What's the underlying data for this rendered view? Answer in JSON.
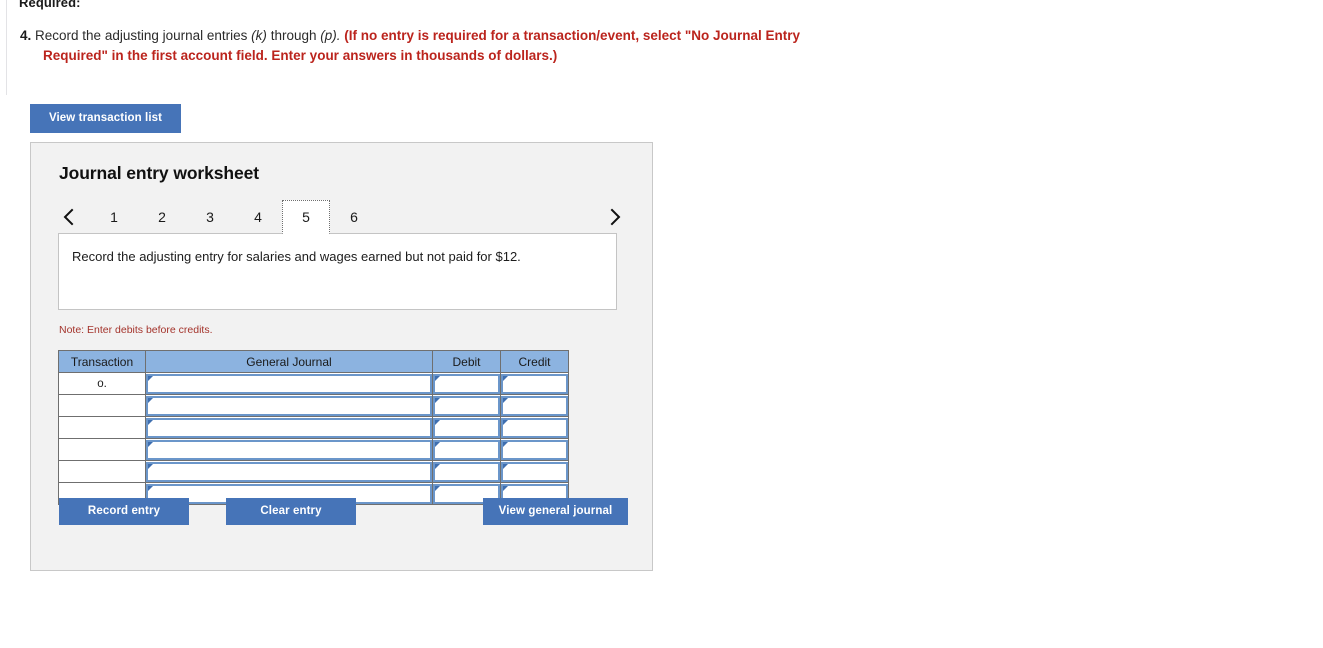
{
  "page": {
    "required_label": "Required:",
    "question": {
      "number": "4.",
      "text_a": "Record the adjusting journal entries",
      "italic_a": "(k)",
      "text_b": "through",
      "italic_b": "(p).",
      "red_a": "(If no entry is required for a transaction/event, select \"No Journal Entry",
      "red_b": "Required\" in the first account field. Enter your answers in thousands of dollars.)"
    },
    "view_transaction_list_label": "View transaction list"
  },
  "worksheet": {
    "title": "Journal entry worksheet",
    "pager": {
      "prev_icon": "chevron-left-icon",
      "next_icon": "chevron-right-icon",
      "pages": [
        "1",
        "2",
        "3",
        "4",
        "5",
        "6"
      ],
      "active_page": "5"
    },
    "prompt": "Record the adjusting entry for salaries and wages earned but not paid for $12.",
    "note": "Note: Enter debits before credits.",
    "table": {
      "headers": [
        "Transaction",
        "General Journal",
        "Debit",
        "Credit"
      ],
      "rows": [
        {
          "transaction": "o.",
          "general_journal": "",
          "debit": "",
          "credit": ""
        },
        {
          "transaction": "",
          "general_journal": "",
          "debit": "",
          "credit": ""
        },
        {
          "transaction": "",
          "general_journal": "",
          "debit": "",
          "credit": ""
        },
        {
          "transaction": "",
          "general_journal": "",
          "debit": "",
          "credit": ""
        },
        {
          "transaction": "",
          "general_journal": "",
          "debit": "",
          "credit": ""
        },
        {
          "transaction": "",
          "general_journal": "",
          "debit": "",
          "credit": ""
        }
      ]
    },
    "buttons": {
      "record_entry": "Record entry",
      "clear_entry": "Clear entry",
      "view_general_journal": "View general journal"
    }
  },
  "colors": {
    "button_blue": "#4674b8",
    "table_header_blue": "#8cb3e0",
    "input_border_blue": "#6b96ca",
    "red_text": "#bb241d",
    "note_red": "#a4342c",
    "panel_bg": "#f2f2f2"
  }
}
